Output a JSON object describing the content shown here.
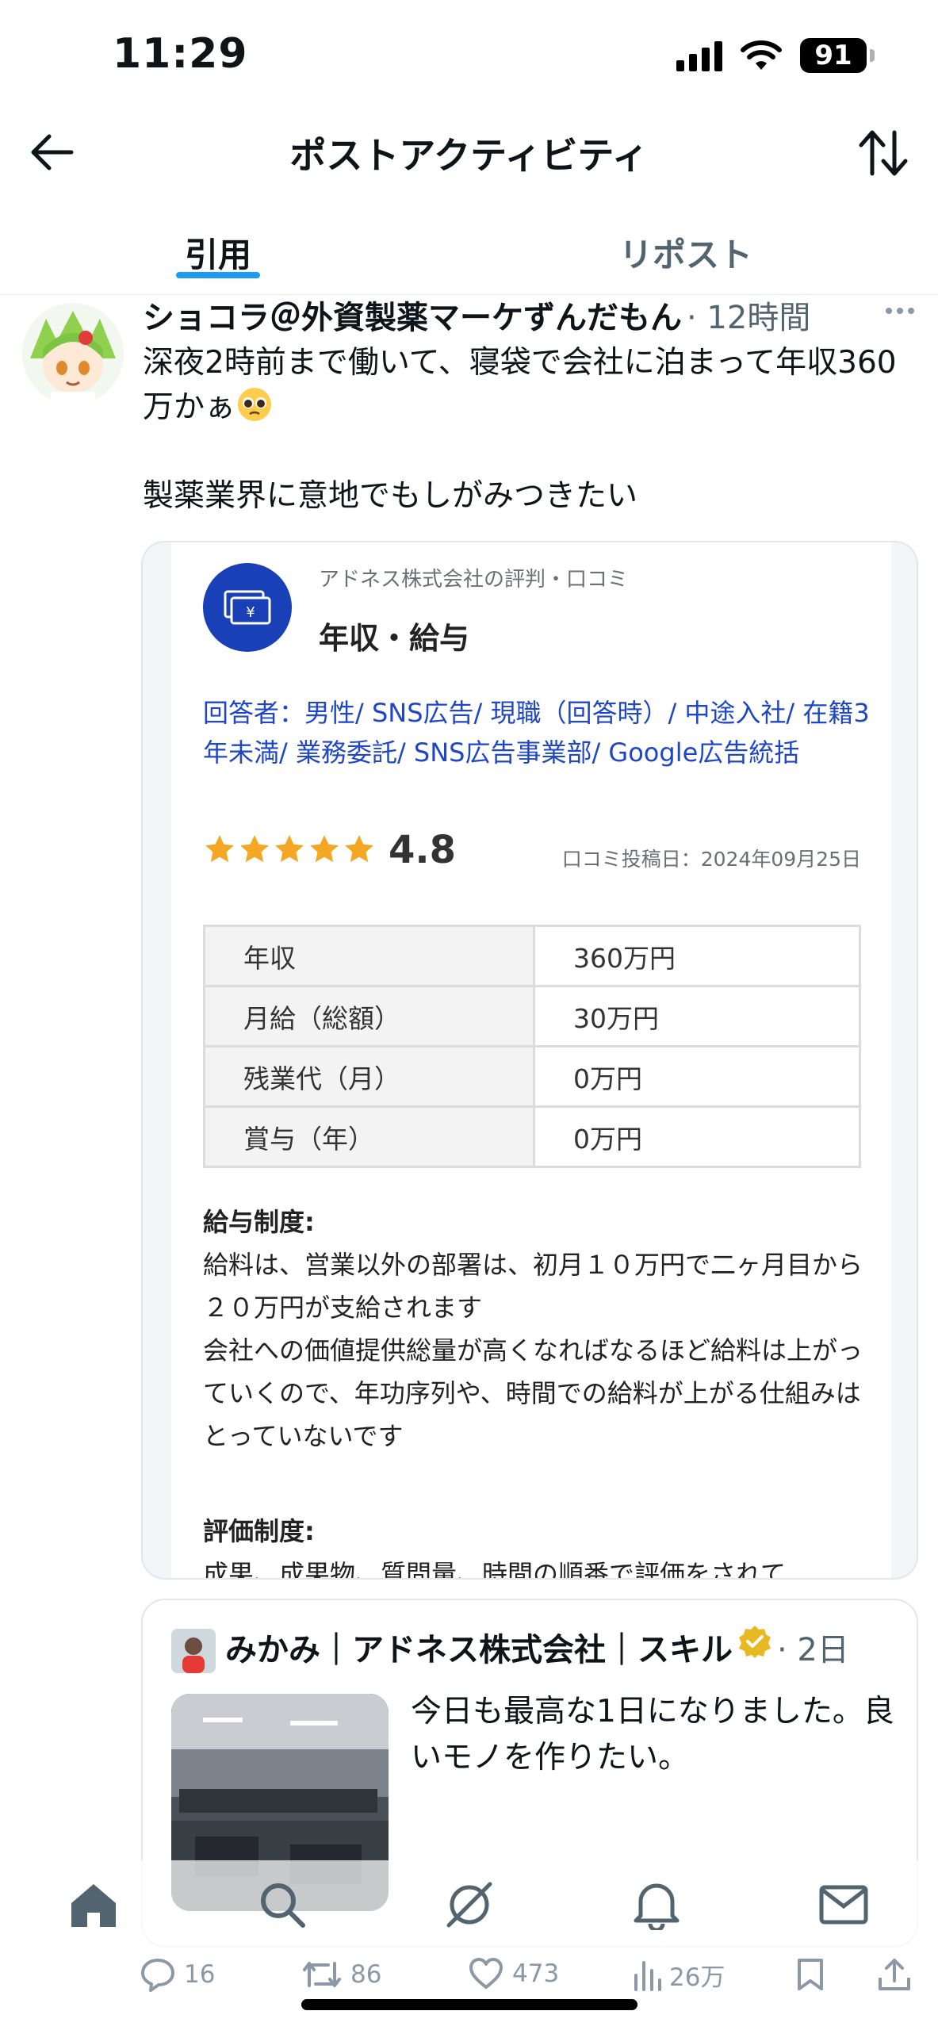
{
  "status_bar": {
    "time": "11:29",
    "battery": "91"
  },
  "header": {
    "title": "ポストアクティビティ"
  },
  "tabs": [
    {
      "label": "引用"
    },
    {
      "label": "リポスト"
    }
  ],
  "post": {
    "author": "ショコラ＠外資製薬マーケずんだもん",
    "time": "· 12時間",
    "text_line1": "深夜2時前まで働いて、寝袋で会社に泊まって年収360万かぁ",
    "text_line2": "製薬業界に意地でもしがみつきたい"
  },
  "card": {
    "subtitle": "アドネス株式会社の評判・口コミ",
    "title": "年収・給与",
    "respondent": "回答者：男性/ SNS広告/ 現職（回答時）/ 中途入社/ 在籍3年未満/ 業務委託/ SNS広告事業部/ Google広告統括",
    "rating": "4.8",
    "review_date": "口コミ投稿日：2024年09月25日",
    "table": [
      {
        "label": "年収",
        "value": "360万円"
      },
      {
        "label": "月給（総額）",
        "value": "30万円"
      },
      {
        "label": "残業代（月）",
        "value": "0万円"
      },
      {
        "label": "賞与（年）",
        "value": "0万円"
      }
    ],
    "salary_system_title": "給与制度:",
    "salary_system_text1": "給料は、営業以外の部署は、初月１０万円で二ヶ月目から２０万円が支給されます",
    "salary_system_text2": "会社への価値提供総量が高くなればなるほど給料は上がっていくので、年功序列や、時間での給料が上がる仕組みはとっていないです",
    "evaluation_title": "評価制度:",
    "evaluation_text": "成果、成果物、質問量、時間の順番で評価をされて"
  },
  "quoted_post": {
    "author": "みかみ｜アドネス株式会社｜スキル",
    "time": "· 2日",
    "text": "今日も最高な1日になりました。良いモノを作りたい。"
  },
  "actions": {
    "replies": "16",
    "reposts": "86",
    "likes": "473",
    "views": "26万"
  },
  "colors": {
    "accent": "#1d9bf0",
    "brand_blue": "#1a40b8",
    "link_blue": "#1f46c6",
    "star": "#f5a623"
  }
}
